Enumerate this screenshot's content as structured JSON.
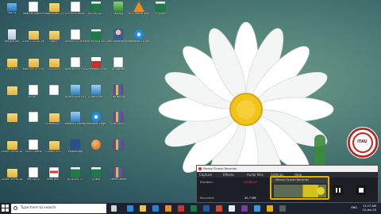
{
  "desktop": {
    "icons": [
      {
        "label": "This PC",
        "type": "pc"
      },
      {
        "label": "internet mock exa...",
        "type": "doc"
      },
      {
        "label": "New folder (3)",
        "type": "folder"
      },
      {
        "label": "S.S PERFORMA...",
        "type": "doc"
      },
      {
        "label": "AGGREGAT...",
        "type": "xls"
      },
      {
        "label": "SMARAJ",
        "type": "green"
      },
      {
        "label": "VLC media player",
        "type": "vlc"
      },
      {
        "label": "PPTiViet",
        "type": "xls"
      },
      {
        "label": "Recycle Bin",
        "type": "bin"
      },
      {
        "label": "LUVE COLLECTION",
        "type": "folder"
      },
      {
        "label": "NNSF",
        "type": "folder"
      },
      {
        "label": "SENIOR STUDENT...",
        "type": "doc"
      },
      {
        "label": "PROPOSED SSS STUDENT...",
        "type": "xls"
      },
      {
        "label": "atc Subscription",
        "type": "person"
      },
      {
        "label": "Windows 10 Update As...",
        "type": "edge"
      },
      {
        "label": "",
        "type": "none"
      },
      {
        "label": "CHEMTEX",
        "type": "folder"
      },
      {
        "label": "MASTER OF COLLEGE",
        "type": "folder"
      },
      {
        "label": "UCCLASS",
        "type": "folder"
      },
      {
        "label": "NEW DELHI ITR...",
        "type": "doc"
      },
      {
        "label": "Dr Manno... Exact",
        "type": "red"
      },
      {
        "label": "AI Agents",
        "type": "doc"
      },
      {
        "label": "",
        "type": "none"
      },
      {
        "label": "",
        "type": "none"
      },
      {
        "label": "",
        "type": "folder"
      },
      {
        "label": "SR DE...",
        "type": "doc"
      },
      {
        "label": "",
        "type": "doc"
      },
      {
        "label": "ADMISSION LIST",
        "type": "net"
      },
      {
        "label": "CONFIGUR...",
        "type": "net"
      },
      {
        "label": "OIB NKERA",
        "type": "rar"
      },
      {
        "label": "",
        "type": "none"
      },
      {
        "label": "",
        "type": "none"
      },
      {
        "label": "",
        "type": "folder"
      },
      {
        "label": "",
        "type": "doc"
      },
      {
        "label": "SUBMISSIO...",
        "type": "folder"
      },
      {
        "label": "Network Manager",
        "type": "net"
      },
      {
        "label": "Microsoft Edge",
        "type": "edge"
      },
      {
        "label": "SCHEDULE...",
        "type": "rar"
      },
      {
        "label": "",
        "type": "none"
      },
      {
        "label": "",
        "type": "none"
      },
      {
        "label": "LEAVE APPLICATION",
        "type": "folder"
      },
      {
        "label": "SSCE Exams",
        "type": "doc"
      },
      {
        "label": "COMPUTER...",
        "type": "folder"
      },
      {
        "label": "PhotoShop",
        "type": "ps"
      },
      {
        "label": "",
        "type": "ball"
      },
      {
        "label": "",
        "type": "rar"
      },
      {
        "label": "",
        "type": "none"
      },
      {
        "label": "",
        "type": "none"
      },
      {
        "label": "LEAVE APPLICATION",
        "type": "folder"
      },
      {
        "label": "MR DOCX",
        "type": "doc"
      },
      {
        "label": "Ariel Bro...",
        "type": "pdf"
      },
      {
        "label": "ACQUISITI...",
        "type": "xls"
      },
      {
        "label": "Q Mod",
        "type": "xls"
      },
      {
        "label": "Sierra Leone",
        "type": "rar"
      },
      {
        "label": "",
        "type": "none"
      },
      {
        "label": "",
        "type": "none"
      },
      {
        "label": "EVENT COLLECTION",
        "type": "folder"
      },
      {
        "label": "",
        "type": "doc"
      },
      {
        "label": "DIARY",
        "type": "red"
      },
      {
        "label": "mogi",
        "type": "doc"
      },
      {
        "label": "bill no.",
        "type": "doc"
      },
      {
        "label": "STUDENT LIST",
        "type": "pdf"
      },
      {
        "label": "",
        "type": "none"
      },
      {
        "label": "",
        "type": "none"
      }
    ]
  },
  "recorder": {
    "title": "Movavi Screen Recorder",
    "menus": [
      "Capture",
      "Effects",
      "Audio files",
      "Settings",
      "Help"
    ],
    "duration_label": "Duration:",
    "duration_value": "00:00:07",
    "recorded_label": "Recorded:",
    "recorded_value": "30.7 MB",
    "mini_title": "Movavi Screen Recorder"
  },
  "taskbar": {
    "search_placeholder": "Type here to search",
    "language": "ENG",
    "time": "11:17 AM",
    "date": "10-Jan-20"
  },
  "seal": {
    "text": "ITAU"
  },
  "colors": {
    "taskbar": "#1b2330",
    "accent": "#e0b300",
    "desktop": "#335e63"
  }
}
